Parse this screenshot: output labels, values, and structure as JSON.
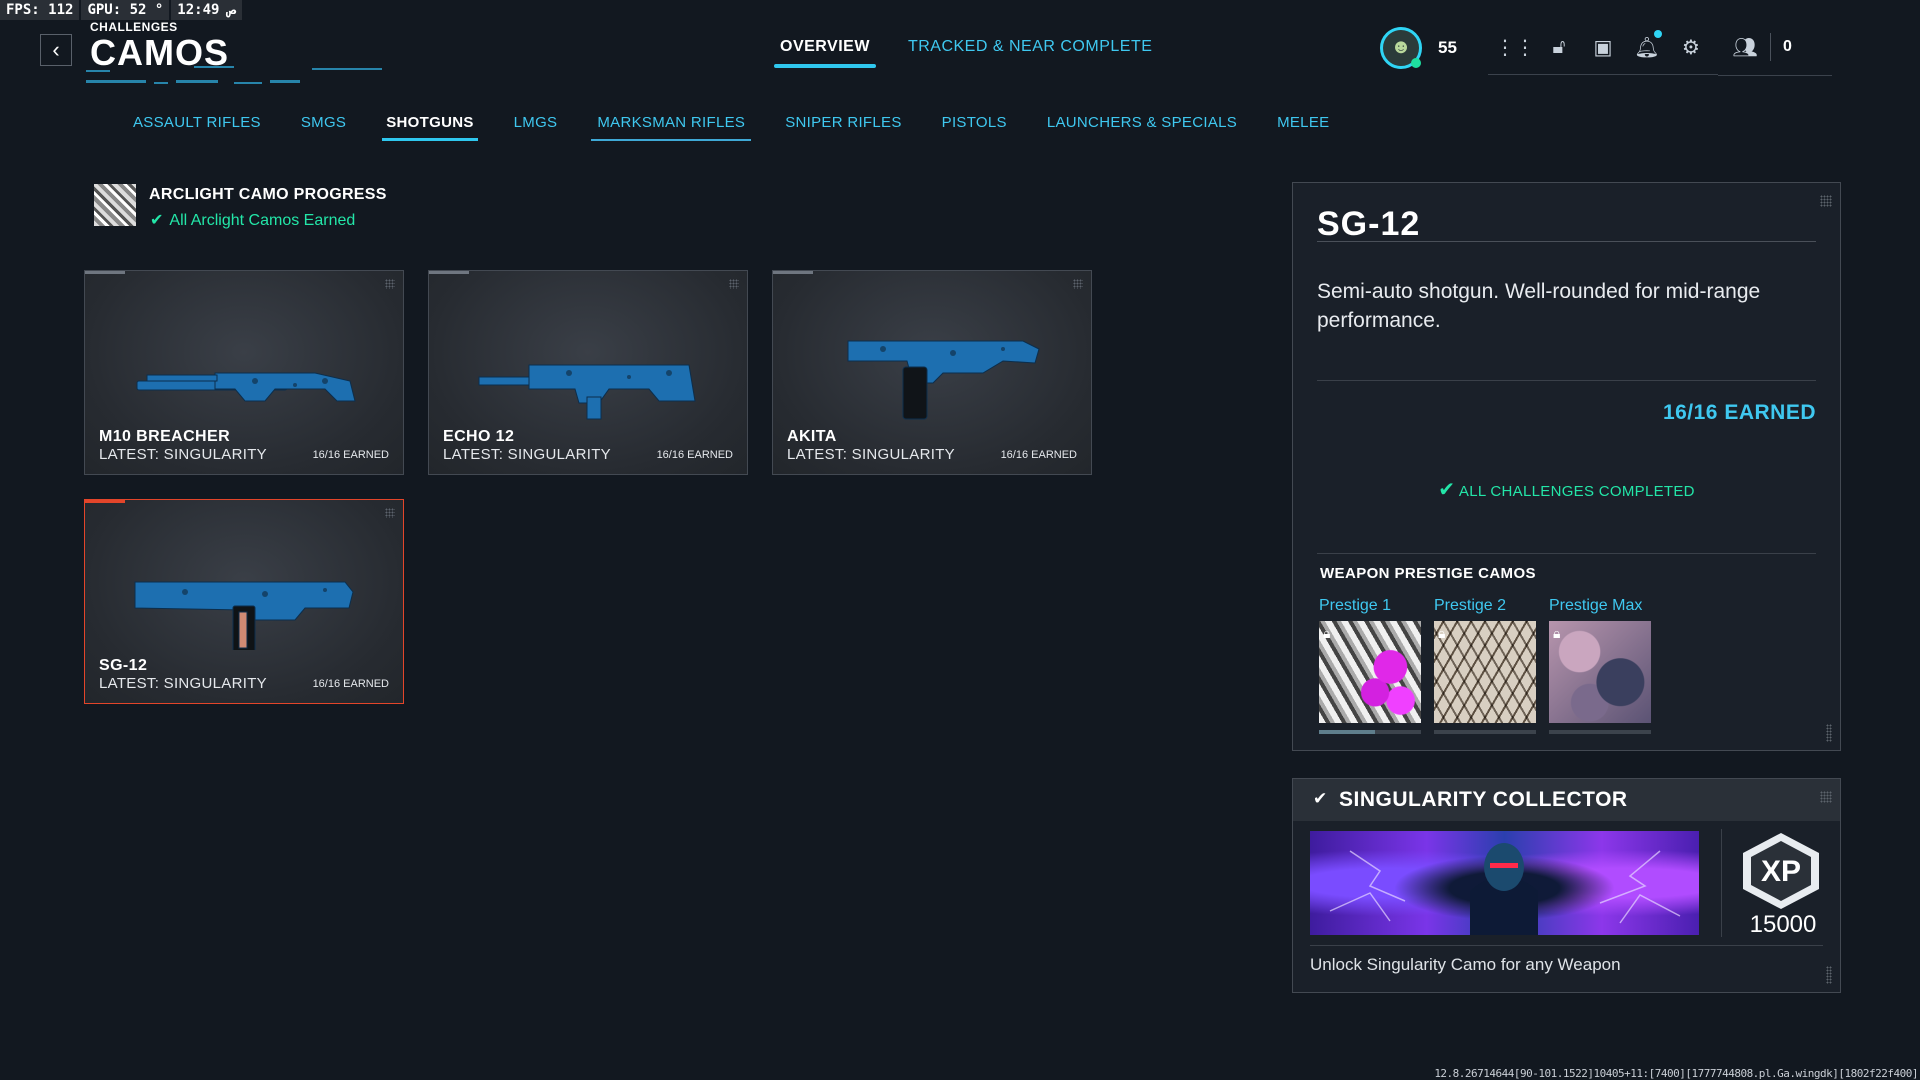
{
  "overlay": {
    "fps": "FPS: 112",
    "gpu": "GPU: 52 °",
    "time": "12:49 ص"
  },
  "header": {
    "breadcrumb": "CHALLENGES",
    "title": "CAMOS",
    "tabs": [
      {
        "label": "OVERVIEW",
        "active": true
      },
      {
        "label": "TRACKED & NEAR COMPLETE",
        "active": false
      }
    ],
    "level": "55",
    "party_count": "0"
  },
  "categories": [
    {
      "label": "ASSAULT RIFLES"
    },
    {
      "label": "SMGS"
    },
    {
      "label": "SHOTGUNS",
      "active": true
    },
    {
      "label": "LMGS"
    },
    {
      "label": "MARKSMAN RIFLES",
      "marked": true
    },
    {
      "label": "SNIPER RIFLES"
    },
    {
      "label": "PISTOLS"
    },
    {
      "label": "LAUNCHERS & SPECIALS"
    },
    {
      "label": "MELEE"
    }
  ],
  "progress": {
    "title": "ARCLIGHT CAMO PROGRESS",
    "status": "All Arclight Camos Earned"
  },
  "weapons": [
    {
      "name": "M10 BREACHER",
      "latest": "LATEST: SINGULARITY",
      "earned": "16/16 EARNED"
    },
    {
      "name": "ECHO 12",
      "latest": "LATEST: SINGULARITY",
      "earned": "16/16 EARNED"
    },
    {
      "name": "AKITA",
      "latest": "LATEST: SINGULARITY",
      "earned": "16/16 EARNED"
    },
    {
      "name": "SG-12",
      "latest": "LATEST: SINGULARITY",
      "earned": "16/16 EARNED",
      "selected": true
    }
  ],
  "detail": {
    "title": "SG-12",
    "description": "Semi-auto shotgun. Well-rounded for mid-range performance.",
    "earned": "16/16 EARNED",
    "completed": "ALL CHALLENGES COMPLETED",
    "prestige_title": "WEAPON PRESTIGE CAMOS",
    "prestige": [
      {
        "label": "Prestige 1",
        "progress": 0.55
      },
      {
        "label": "Prestige 2",
        "progress": 0
      },
      {
        "label": "Prestige Max",
        "progress": 0
      }
    ]
  },
  "collector": {
    "title": "SINGULARITY COLLECTOR",
    "xp_badge": "XP",
    "xp_amount": "15000",
    "description": "Unlock Singularity Camo for any Weapon"
  },
  "build_info": "12.8.26714644[90-101.1522]10405+11:[7400][1777744808.pl.Ga.wingdk][1802f22f400]",
  "colors": {
    "accent": "#2fc7ee",
    "success": "#23e6a8",
    "selected_border": "#e3452a",
    "background": "#121820"
  }
}
